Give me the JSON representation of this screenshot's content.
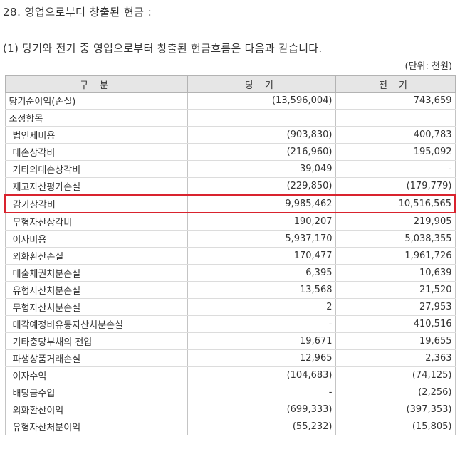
{
  "title": "28. 영업으로부터 창출된 현금 :",
  "subtitle": "(1) 당기와 전기 중 영업으로부터 창출된 현금흐름은 다음과 같습니다.",
  "unit_note": "(단위: 천원)",
  "table": {
    "headers": [
      "구 분",
      "당 기",
      "전 기"
    ],
    "rows": [
      {
        "label": "당기순이익(손실)",
        "current": "(13,596,004)",
        "prior": "743,659",
        "indent": false,
        "highlight": false
      },
      {
        "label": "조정항목",
        "current": "",
        "prior": "",
        "indent": false,
        "highlight": false
      },
      {
        "label": "법인세비용",
        "current": "(903,830)",
        "prior": "400,783",
        "indent": true,
        "highlight": false
      },
      {
        "label": "대손상각비",
        "current": "(216,960)",
        "prior": "195,092",
        "indent": true,
        "highlight": false
      },
      {
        "label": "기타의대손상각비",
        "current": "39,049",
        "prior": "-",
        "indent": true,
        "highlight": false
      },
      {
        "label": "재고자산평가손실",
        "current": "(229,850)",
        "prior": "(179,779)",
        "indent": true,
        "highlight": false
      },
      {
        "label": "감가상각비",
        "current": "9,985,462",
        "prior": "10,516,565",
        "indent": true,
        "highlight": true
      },
      {
        "label": "무형자산상각비",
        "current": "190,207",
        "prior": "219,905",
        "indent": true,
        "highlight": false
      },
      {
        "label": "이자비용",
        "current": "5,937,170",
        "prior": "5,038,355",
        "indent": true,
        "highlight": false
      },
      {
        "label": "외화환산손실",
        "current": "170,477",
        "prior": "1,961,726",
        "indent": true,
        "highlight": false
      },
      {
        "label": "매출채권처분손실",
        "current": "6,395",
        "prior": "10,639",
        "indent": true,
        "highlight": false
      },
      {
        "label": "유형자산처분손실",
        "current": "13,568",
        "prior": "21,520",
        "indent": true,
        "highlight": false
      },
      {
        "label": "무형자산처분손실",
        "current": "2",
        "prior": "27,953",
        "indent": true,
        "highlight": false
      },
      {
        "label": "매각예정비유동자산처분손실",
        "current": "-",
        "prior": "410,516",
        "indent": true,
        "highlight": false
      },
      {
        "label": "기타충당부채의 전입",
        "current": "19,671",
        "prior": "19,655",
        "indent": true,
        "highlight": false
      },
      {
        "label": "파생상품거래손실",
        "current": "12,965",
        "prior": "2,363",
        "indent": true,
        "highlight": false
      },
      {
        "label": "이자수익",
        "current": "(104,683)",
        "prior": "(74,125)",
        "indent": true,
        "highlight": false
      },
      {
        "label": "배당금수입",
        "current": "-",
        "prior": "(2,256)",
        "indent": true,
        "highlight": false
      },
      {
        "label": "외화환산이익",
        "current": "(699,333)",
        "prior": "(397,353)",
        "indent": true,
        "highlight": false
      },
      {
        "label": "유형자산처분이익",
        "current": "(55,232)",
        "prior": "(15,805)",
        "indent": true,
        "highlight": false
      }
    ]
  },
  "colors": {
    "highlight_border": "#d9232e",
    "header_bg": "#e6e6e6"
  }
}
